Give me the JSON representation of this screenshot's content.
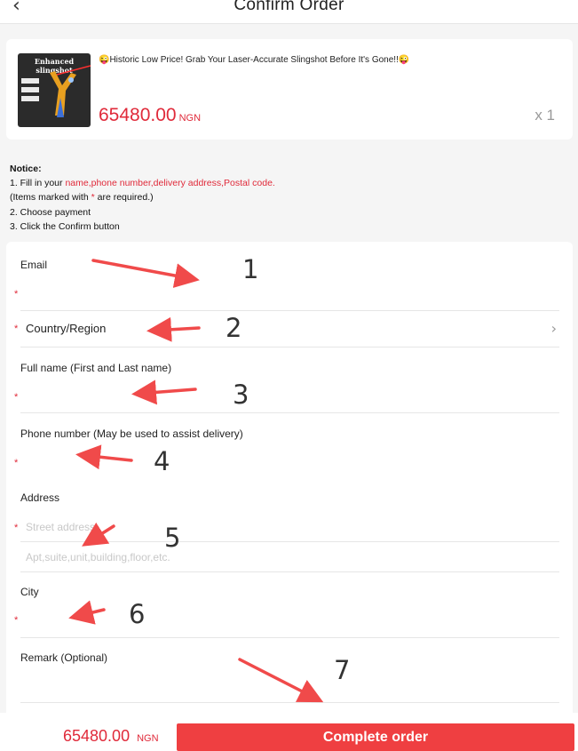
{
  "header": {
    "back_icon": "chevron-left-icon",
    "title": "Confirm Order"
  },
  "product": {
    "image_text": "Enhanced slingshot",
    "title": "😜Historic Low Price! Grab Your Laser-Accurate Slingshot Before It's Gone!!😜",
    "price": "65480.00",
    "currency": "NGN",
    "quantity": "x 1"
  },
  "notice": {
    "heading": "Notice:",
    "line1_prefix": "1. Fill in your ",
    "line1_fields": "name,phone number,delivery address,Postal code.",
    "line2_prefix": "(Items marked with ",
    "line2_star": "*",
    "line2_suffix": " are required.)",
    "line3": "2. Choose payment",
    "line4": "3. Click the Confirm button"
  },
  "form": {
    "email_label": "Email",
    "country_label": "Country/Region",
    "fullname_label": "Full name (First and Last name)",
    "phone_label": "Phone number (May be used to assist delivery)",
    "address_label": "Address",
    "street_placeholder": "Street address",
    "apt_placeholder": "Apt,suite,unit,building,floor,etc.",
    "city_label": "City",
    "remark_label": "Remark (Optional)",
    "required_star": "*"
  },
  "annotations": [
    "1",
    "2",
    "3",
    "4",
    "5",
    "6",
    "7"
  ],
  "footer": {
    "total_price": "65480.00",
    "currency": "NGN",
    "complete_label": "Complete order"
  },
  "colors": {
    "accent_red": "#e02a3a",
    "button_red": "#ef3f41",
    "arrow_red": "#f04a4a"
  }
}
